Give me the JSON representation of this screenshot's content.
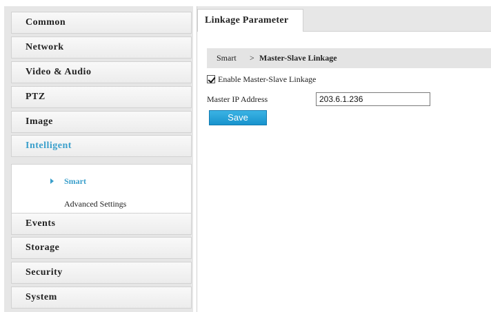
{
  "sidebar": {
    "items": [
      {
        "label": "Common"
      },
      {
        "label": "Network"
      },
      {
        "label": "Video & Audio"
      },
      {
        "label": "PTZ"
      },
      {
        "label": "Image"
      },
      {
        "label": "Intelligent"
      },
      {
        "label": "Events"
      },
      {
        "label": "Storage"
      },
      {
        "label": "Security"
      },
      {
        "label": "System"
      }
    ],
    "active_item": "Intelligent",
    "submenu": [
      {
        "label": "Smart",
        "selected": true
      },
      {
        "label": "Advanced Settings",
        "selected": false
      }
    ]
  },
  "main": {
    "tab_label": "Linkage Parameter",
    "breadcrumb": {
      "root": "Smart",
      "separator": ">",
      "current": "Master-Slave Linkage"
    },
    "enable_checkbox": {
      "label": "Enable Master-Slave Linkage",
      "checked": true
    },
    "master_ip": {
      "label": "Master IP Address",
      "value": "203.6.1.236"
    },
    "save_label": "Save"
  },
  "colors": {
    "accent": "#3a9fcb",
    "button": "#1e9ad6",
    "panel_gray": "#e6e6e6"
  }
}
